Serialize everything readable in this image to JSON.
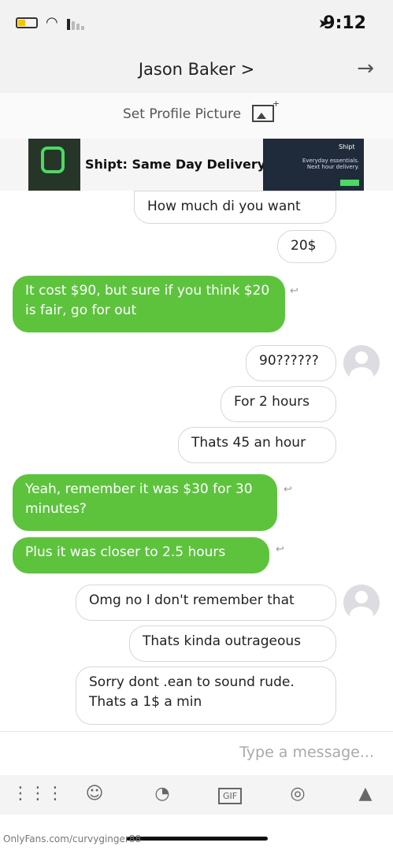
{
  "status_bar": {
    "time": "9:12"
  },
  "header": {
    "contact_name": "Jason Baker >"
  },
  "profile": {
    "set_picture_label": "Set Profile Picture"
  },
  "ad": {
    "headline": "Shipt: Same Day Delivery",
    "brand": "Shipt",
    "tagline": "Everyday essentials. Next hour delivery."
  },
  "messages": [
    {
      "side": "received",
      "text": "How much di you want"
    },
    {
      "side": "received",
      "text": "20$"
    },
    {
      "side": "sent",
      "text": "It cost $90, but sure if you think $20 is fair, go for out"
    },
    {
      "side": "received",
      "text": "90??????"
    },
    {
      "side": "received",
      "text": "For 2 hours"
    },
    {
      "side": "received",
      "text": "Thats 45 an hour"
    },
    {
      "side": "sent",
      "text": "Yeah, remember it was $30 for 30 minutes?"
    },
    {
      "side": "sent",
      "text": "Plus it was closer to 2.5 hours"
    },
    {
      "side": "received",
      "text": "Omg no I don't remember that"
    },
    {
      "side": "received",
      "text": "Thats kinda outrageous"
    },
    {
      "side": "received",
      "text": "Sorry dont .ean to sound rude. Thats a 1$ a min"
    }
  ],
  "composer": {
    "placeholder": "Type a message..."
  },
  "toolbar": {
    "gif_label": "GIF"
  },
  "watermark": "OnlyFans.com/curvyginger88"
}
